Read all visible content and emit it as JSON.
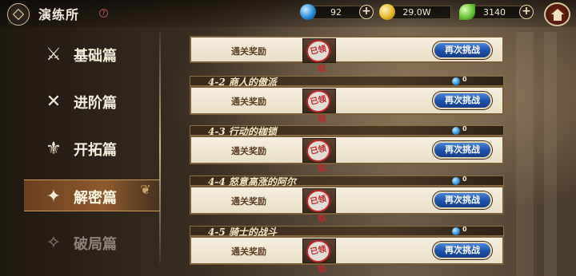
{
  "header": {
    "title": "演练所",
    "help_icon": "question-icon",
    "back_icon": "back-diamond-icon",
    "home_icon": "home-icon"
  },
  "resources": [
    {
      "name": "gem",
      "icon": "blue-gem-icon",
      "value": "92",
      "color": "#2a8cd6"
    },
    {
      "name": "gold",
      "icon": "gold-coin-icon",
      "value": "29.0W",
      "color": "#e6b82a"
    },
    {
      "name": "leaf",
      "icon": "green-leaf-icon",
      "value": "3140",
      "color": "#6ac23a"
    }
  ],
  "sidebar": {
    "items": [
      {
        "label": "基础篇",
        "icon": "sword-emblem-icon",
        "state": "normal"
      },
      {
        "label": "进阶篇",
        "icon": "crossed-swords-icon",
        "state": "normal"
      },
      {
        "label": "开拓篇",
        "icon": "triple-sword-icon",
        "state": "normal"
      },
      {
        "label": "解密篇",
        "icon": "key-emblem-icon",
        "state": "active"
      },
      {
        "label": "破局篇",
        "icon": "broken-sword-icon",
        "state": "disabled"
      }
    ]
  },
  "stages": [
    {
      "name": "",
      "gem_count": "",
      "reward_label": "通关奖励",
      "stamp": "已领取",
      "button": "再次挑战"
    },
    {
      "name": "4-2 商人的傲派",
      "gem_count": "0",
      "reward_label": "通关奖励",
      "stamp": "已领取",
      "button": "再次挑战"
    },
    {
      "name": "4-3 行动的枷锁",
      "gem_count": "0",
      "reward_label": "通关奖励",
      "stamp": "已领取",
      "button": "再次挑战"
    },
    {
      "name": "4-4 怒意高涨的阿尔",
      "gem_count": "0",
      "reward_label": "通关奖励",
      "stamp": "已领取",
      "button": "再次挑战"
    },
    {
      "name": "4-5 骑士的战斗",
      "gem_count": "0",
      "reward_label": "通关奖励",
      "stamp": "已领取",
      "button": "再次挑战"
    }
  ]
}
